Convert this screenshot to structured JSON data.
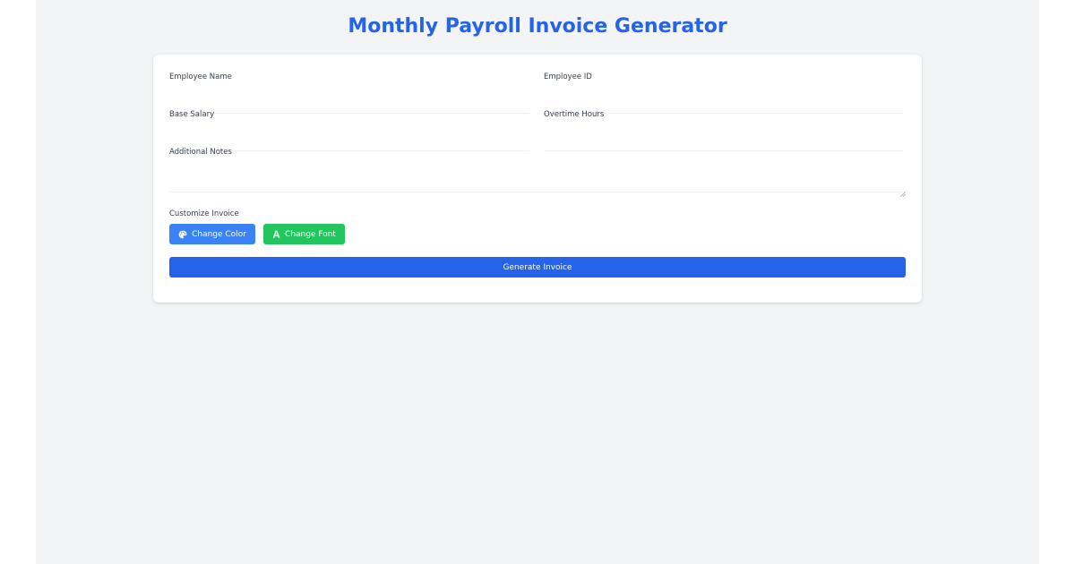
{
  "page": {
    "title": "Monthly Payroll Invoice Generator"
  },
  "form": {
    "employee_name": {
      "label": "Employee Name",
      "value": "",
      "placeholder": ""
    },
    "employee_id": {
      "label": "Employee ID",
      "value": "",
      "placeholder": ""
    },
    "base_salary": {
      "label": "Base Salary",
      "value": "",
      "placeholder": ""
    },
    "overtime_hours": {
      "label": "Overtime Hours",
      "value": "",
      "placeholder": ""
    },
    "additional_notes": {
      "label": "Additional Notes",
      "value": "",
      "placeholder": ""
    }
  },
  "customize": {
    "label": "Customize Invoice",
    "change_color": {
      "label": "Change Color",
      "icon": "palette-icon"
    },
    "change_font": {
      "label": "Change Font",
      "icon": "font-icon"
    }
  },
  "actions": {
    "generate_label": "Generate Invoice"
  },
  "colors": {
    "accent": "#2563eb",
    "color_button": "#3b82f6",
    "font_button": "#22c55e",
    "background": "#f3f4f6"
  }
}
